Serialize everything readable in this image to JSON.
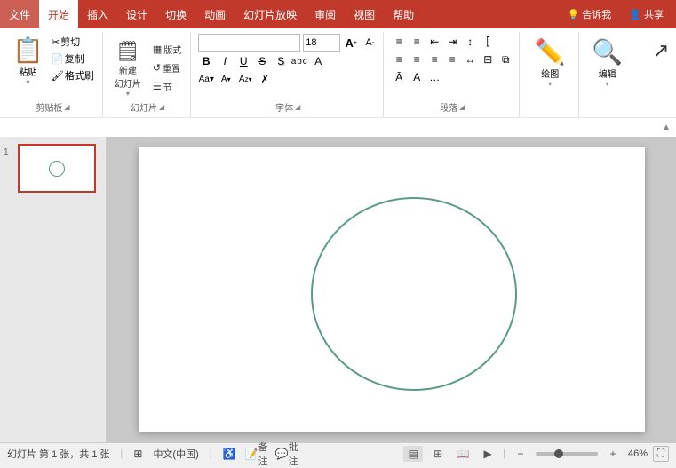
{
  "titlebar": {
    "menus": [
      "文件",
      "开始",
      "插入",
      "设计",
      "切换",
      "动画",
      "幻灯片放映",
      "审阅",
      "视图",
      "帮助"
    ],
    "active_menu": "开始",
    "right_items": [
      "告诉我",
      "共享"
    ],
    "tell_me_icon": "💡",
    "share_icon": "👤"
  },
  "ribbon": {
    "groups": {
      "clipboard": {
        "label": "剪贴板",
        "paste_label": "粘贴",
        "cut_label": "剪切",
        "copy_label": "复制",
        "format_painter_label": "格式刷"
      },
      "slides": {
        "label": "幻灯片",
        "new_slide_label": "新建\n幻灯片",
        "layout_label": "版式",
        "reset_label": "重置",
        "section_label": "节"
      },
      "font": {
        "label": "字体",
        "font_name": "",
        "font_size": "18",
        "bold": "B",
        "italic": "I",
        "underline": "U",
        "strikethrough": "S",
        "shadow": "S",
        "char_spacing_label": "abc",
        "font_color_label": "A",
        "increase_size": "A",
        "decrease_size": "A"
      },
      "paragraph": {
        "label": "段落",
        "expand_icon": "◢"
      },
      "drawing": {
        "label": "绘图",
        "btn_label": "绘图"
      },
      "editing": {
        "label": "编辑",
        "btn_label": "编辑"
      }
    }
  },
  "slides_panel": {
    "slides": [
      {
        "number": "1"
      }
    ]
  },
  "canvas": {
    "slide_number": 1,
    "circle": {
      "color": "#5a9a8a",
      "stroke_width": 2
    }
  },
  "statusbar": {
    "slide_info": "幻灯片 第 1 张，共 1 张",
    "language": "中文(中国)",
    "notes_label": "备注",
    "comments_label": "批注",
    "zoom_percent": "46%",
    "zoom_value": 46,
    "views": [
      "普通视图",
      "幻灯片浏览",
      "阅读视图"
    ],
    "accessibility_icon": "♿",
    "notes_icon": "📝",
    "comments_icon": "💬"
  },
  "icons": {
    "paste": "📋",
    "cut": "✂",
    "copy": "📄",
    "format_painter": "🖌",
    "new_slide": "➕",
    "drawing": "✏️",
    "editing": "🔍",
    "cursor": "↖",
    "zoom_out": "−",
    "zoom_in": "+",
    "fit_screen": "⛶",
    "bold": "B",
    "italic": "I",
    "underline": "U",
    "strikethrough": "S"
  }
}
